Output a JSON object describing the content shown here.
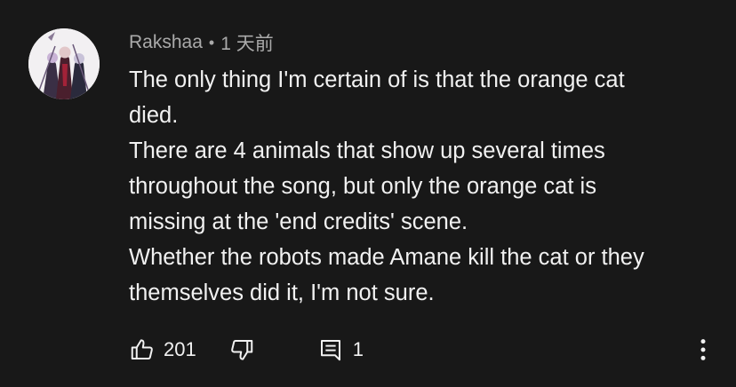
{
  "comment": {
    "author": "Rakshaa",
    "separator": "•",
    "timestamp": "1 天前",
    "text_lines": [
      "The only thing I'm certain of is that the orange cat",
      "died.",
      "There are 4 animals that show up several times",
      "throughout the song, but only the orange cat is",
      "missing at the 'end credits' scene.",
      "Whether the robots made Amane kill the cat or they",
      "themselves did it, I'm not sure."
    ],
    "like_count": "201",
    "reply_count": "1"
  },
  "icons": {
    "like": "thumbs-up-icon",
    "dislike": "thumbs-down-icon",
    "reply": "comment-reply-icon",
    "more": "more-vertical-icon"
  },
  "colors": {
    "background": "#181818",
    "text_primary": "#f1f1f1",
    "text_secondary": "#aaaaaa"
  }
}
